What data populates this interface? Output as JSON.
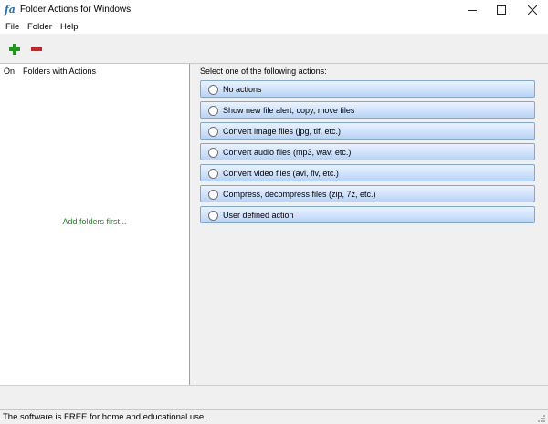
{
  "window": {
    "app_icon_text": "fa",
    "title": "Folder Actions for Windows",
    "controls": [
      "minimize-icon",
      "maximize-icon",
      "close-icon"
    ]
  },
  "menu": {
    "items": [
      "File",
      "Folder",
      "Help"
    ]
  },
  "toolbar": {
    "icons": [
      "plus-icon",
      "minus-icon"
    ],
    "colors": {
      "add": "#1a9a1a",
      "remove": "#d42020"
    }
  },
  "folders_panel": {
    "col_on": "On",
    "col_folders": "Folders with Actions",
    "empty_hint": "Add folders first..."
  },
  "actions_panel": {
    "caption": "Select one of the following actions:",
    "options": [
      "No actions",
      "Show new file alert, copy, move files",
      "Convert image files (jpg, tif, etc.)",
      "Convert audio files (mp3, wav, etc.)",
      "Convert video files (avi, flv, etc.)",
      "Compress, decompress files (zip, 7z, etc.)",
      "User defined action"
    ]
  },
  "status": {
    "text": "The software is FREE for home and educational use."
  }
}
